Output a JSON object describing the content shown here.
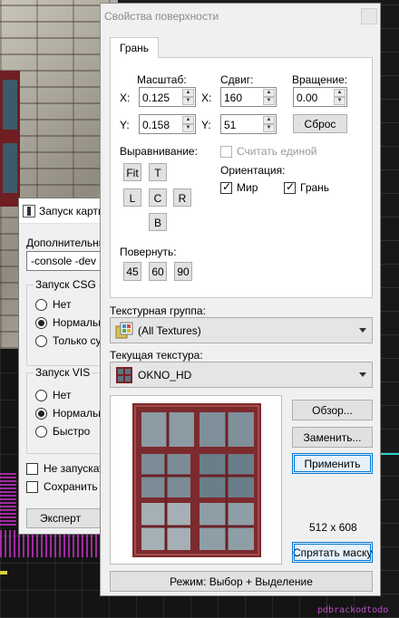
{
  "background": {
    "bottom_right_text": "pdbrackodtodo"
  },
  "left_dialog": {
    "title": "Запуск карты",
    "extra_label": "Дополнительные",
    "extra_value": "-console -dev",
    "csg_group": {
      "label": "Запуск CSG",
      "options": [
        "Нет",
        "Нормально",
        "Только сущн"
      ],
      "selected_index": 1
    },
    "vis_group": {
      "label": "Запуск VIS",
      "options": [
        "Нет",
        "Нормально",
        "Быстро"
      ],
      "selected_index": 1
    },
    "checkboxes": [
      {
        "label": "Не запускать",
        "checked": false
      },
      {
        "label": "Сохранить т",
        "checked": false
      }
    ],
    "expert_button": "Эксперт"
  },
  "main_dialog": {
    "title": "Свойства поверхности",
    "tab_label": "Грань",
    "scale": {
      "label": "Масштаб:",
      "x_label": "X:",
      "x_value": "0.125",
      "y_label": "Y:",
      "y_value": "0.158"
    },
    "shift": {
      "label": "Сдвиг:",
      "x_label": "X:",
      "x_value": "160",
      "y_label": "Y:",
      "y_value": "51"
    },
    "rotation": {
      "label": "Вращение:",
      "value": "0.00",
      "reset_button": "Сброс"
    },
    "align": {
      "label": "Выравнивание:",
      "buttons": {
        "fit": "Fit",
        "top": "T",
        "left": "L",
        "center": "C",
        "right": "R",
        "bottom": "B"
      }
    },
    "treat_as_one": {
      "label": "Считать единой",
      "checked": false,
      "disabled": true
    },
    "orientation": {
      "label": "Ориентация:",
      "world": {
        "label": "Мир",
        "checked": true
      },
      "face": {
        "label": "Грань",
        "checked": true
      }
    },
    "rotate": {
      "label": "Повернуть:",
      "buttons": [
        "45",
        "60",
        "90"
      ]
    },
    "texture_group": {
      "label": "Текстурная группа:",
      "value": "(All Textures)"
    },
    "current_texture": {
      "label": "Текущая текстура:",
      "value": "OKNO_HD"
    },
    "buttons": {
      "browse": "Обзор...",
      "replace": "Заменить...",
      "apply": "Применить",
      "hide_mask": "Спрятать маску"
    },
    "texture_size": "512 x 608",
    "mode_button": "Режим: Выбор + Выделение"
  }
}
